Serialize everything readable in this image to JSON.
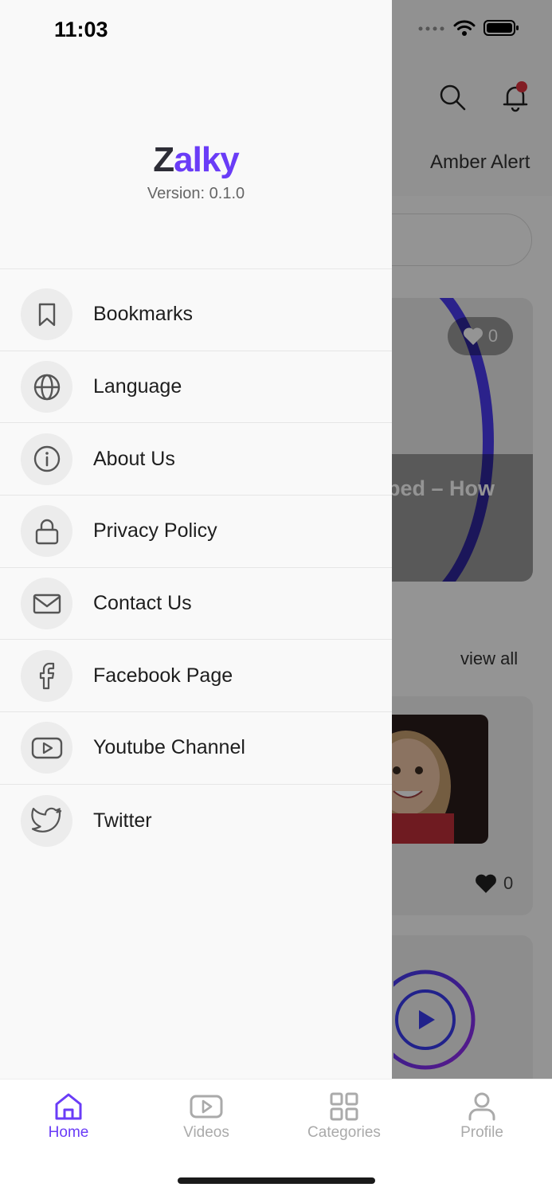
{
  "status_bar": {
    "time": "11:03"
  },
  "background": {
    "tab_label": "Amber Alert",
    "card_title": "bed – How",
    "card_likes": "0",
    "view_all": "view all",
    "list_likes": "0"
  },
  "drawer": {
    "brand_first": "Z",
    "brand_rest": "alky",
    "version": "Version: 0.1.0",
    "items": [
      {
        "label": "Bookmarks",
        "icon": "bookmark-icon"
      },
      {
        "label": "Language",
        "icon": "globe-icon"
      },
      {
        "label": "About Us",
        "icon": "info-icon"
      },
      {
        "label": "Privacy Policy",
        "icon": "lock-icon"
      },
      {
        "label": "Contact Us",
        "icon": "mail-icon"
      },
      {
        "label": "Facebook Page",
        "icon": "facebook-icon"
      },
      {
        "label": "Youtube Channel",
        "icon": "youtube-icon"
      },
      {
        "label": "Twitter",
        "icon": "twitter-icon"
      }
    ]
  },
  "bottom_nav": {
    "items": [
      {
        "label": "Home",
        "icon": "home-icon",
        "active": true
      },
      {
        "label": "Videos",
        "icon": "video-icon",
        "active": false
      },
      {
        "label": "Categories",
        "icon": "grid-icon",
        "active": false
      },
      {
        "label": "Profile",
        "icon": "user-icon",
        "active": false
      }
    ]
  },
  "colors": {
    "accent": "#6a3cf7",
    "brand_dark": "#2d2d36",
    "inactive": "#aaaaaa"
  }
}
